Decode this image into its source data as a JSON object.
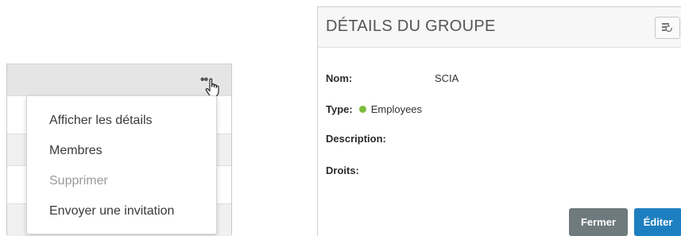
{
  "context_menu": {
    "items": [
      {
        "label": "Afficher les détails",
        "enabled": true
      },
      {
        "label": "Membres",
        "enabled": true
      },
      {
        "label": "Supprimer",
        "enabled": false
      },
      {
        "label": "Envoyer une invitation",
        "enabled": true
      }
    ],
    "trigger_icon": "more-dots-icon",
    "cursor_icon": "hand-pointer-icon"
  },
  "details_panel": {
    "title": "DÉTAILS DU GROUPE",
    "refresh_icon": "refresh-icon",
    "fields": {
      "name": {
        "label": "Nom:",
        "value": "SCIA"
      },
      "type": {
        "label": "Type:",
        "value": "Employees",
        "status_color": "#7cbb3b"
      },
      "description": {
        "label": "Description:",
        "value": ""
      },
      "rights": {
        "label": "Droits:",
        "value": ""
      }
    },
    "buttons": {
      "close_label": "Fermer",
      "edit_label": "Éditer"
    },
    "colors": {
      "close_button": "#6e7a7d",
      "edit_button": "#1e7fc0"
    }
  }
}
